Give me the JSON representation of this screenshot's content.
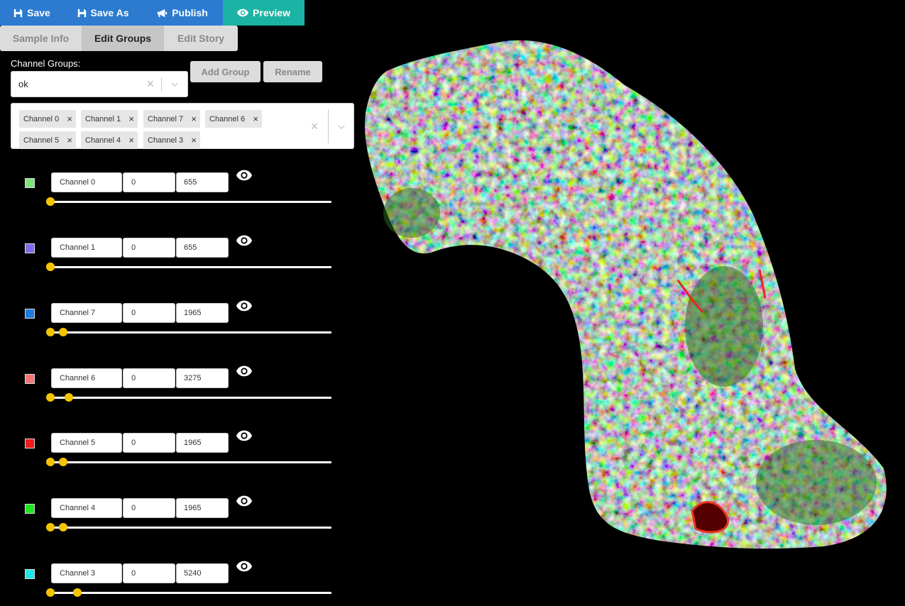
{
  "toolbar": {
    "save": "Save",
    "save_as": "Save As",
    "publish": "Publish",
    "preview": "Preview"
  },
  "tabs": [
    "Sample Info",
    "Edit Groups",
    "Edit Story"
  ],
  "active_tab": "Edit Groups",
  "channel_groups": {
    "label": "Channel Groups:",
    "selected": "ok",
    "add_label": "Add Group",
    "rename_label": "Rename"
  },
  "selected_channels": [
    "Channel 0",
    "Channel 1",
    "Channel 7",
    "Channel 6",
    "Channel 5",
    "Channel 4",
    "Channel 3"
  ],
  "channels": [
    {
      "name": "Channel 0",
      "min": "0",
      "max": "655",
      "color": "#7ee37a",
      "low": 0.0,
      "high": 0.0
    },
    {
      "name": "Channel 1",
      "min": "0",
      "max": "655",
      "color": "#7b6ee6",
      "low": 0.0,
      "high": 0.0
    },
    {
      "name": "Channel 7",
      "min": "0",
      "max": "1965",
      "color": "#1f7be0",
      "low": 0.0,
      "high": 0.03
    },
    {
      "name": "Channel 6",
      "min": "0",
      "max": "3275",
      "color": "#f07575",
      "low": 0.0,
      "high": 0.05
    },
    {
      "name": "Channel 5",
      "min": "0",
      "max": "1965",
      "color": "#ef1a1a",
      "low": 0.0,
      "high": 0.03
    },
    {
      "name": "Channel 4",
      "min": "0",
      "max": "1965",
      "color": "#1fe61f",
      "low": 0.0,
      "high": 0.03
    },
    {
      "name": "Channel 3",
      "min": "0",
      "max": "5240",
      "color": "#1fe6e6",
      "low": 0.0,
      "high": 0.08
    }
  ]
}
